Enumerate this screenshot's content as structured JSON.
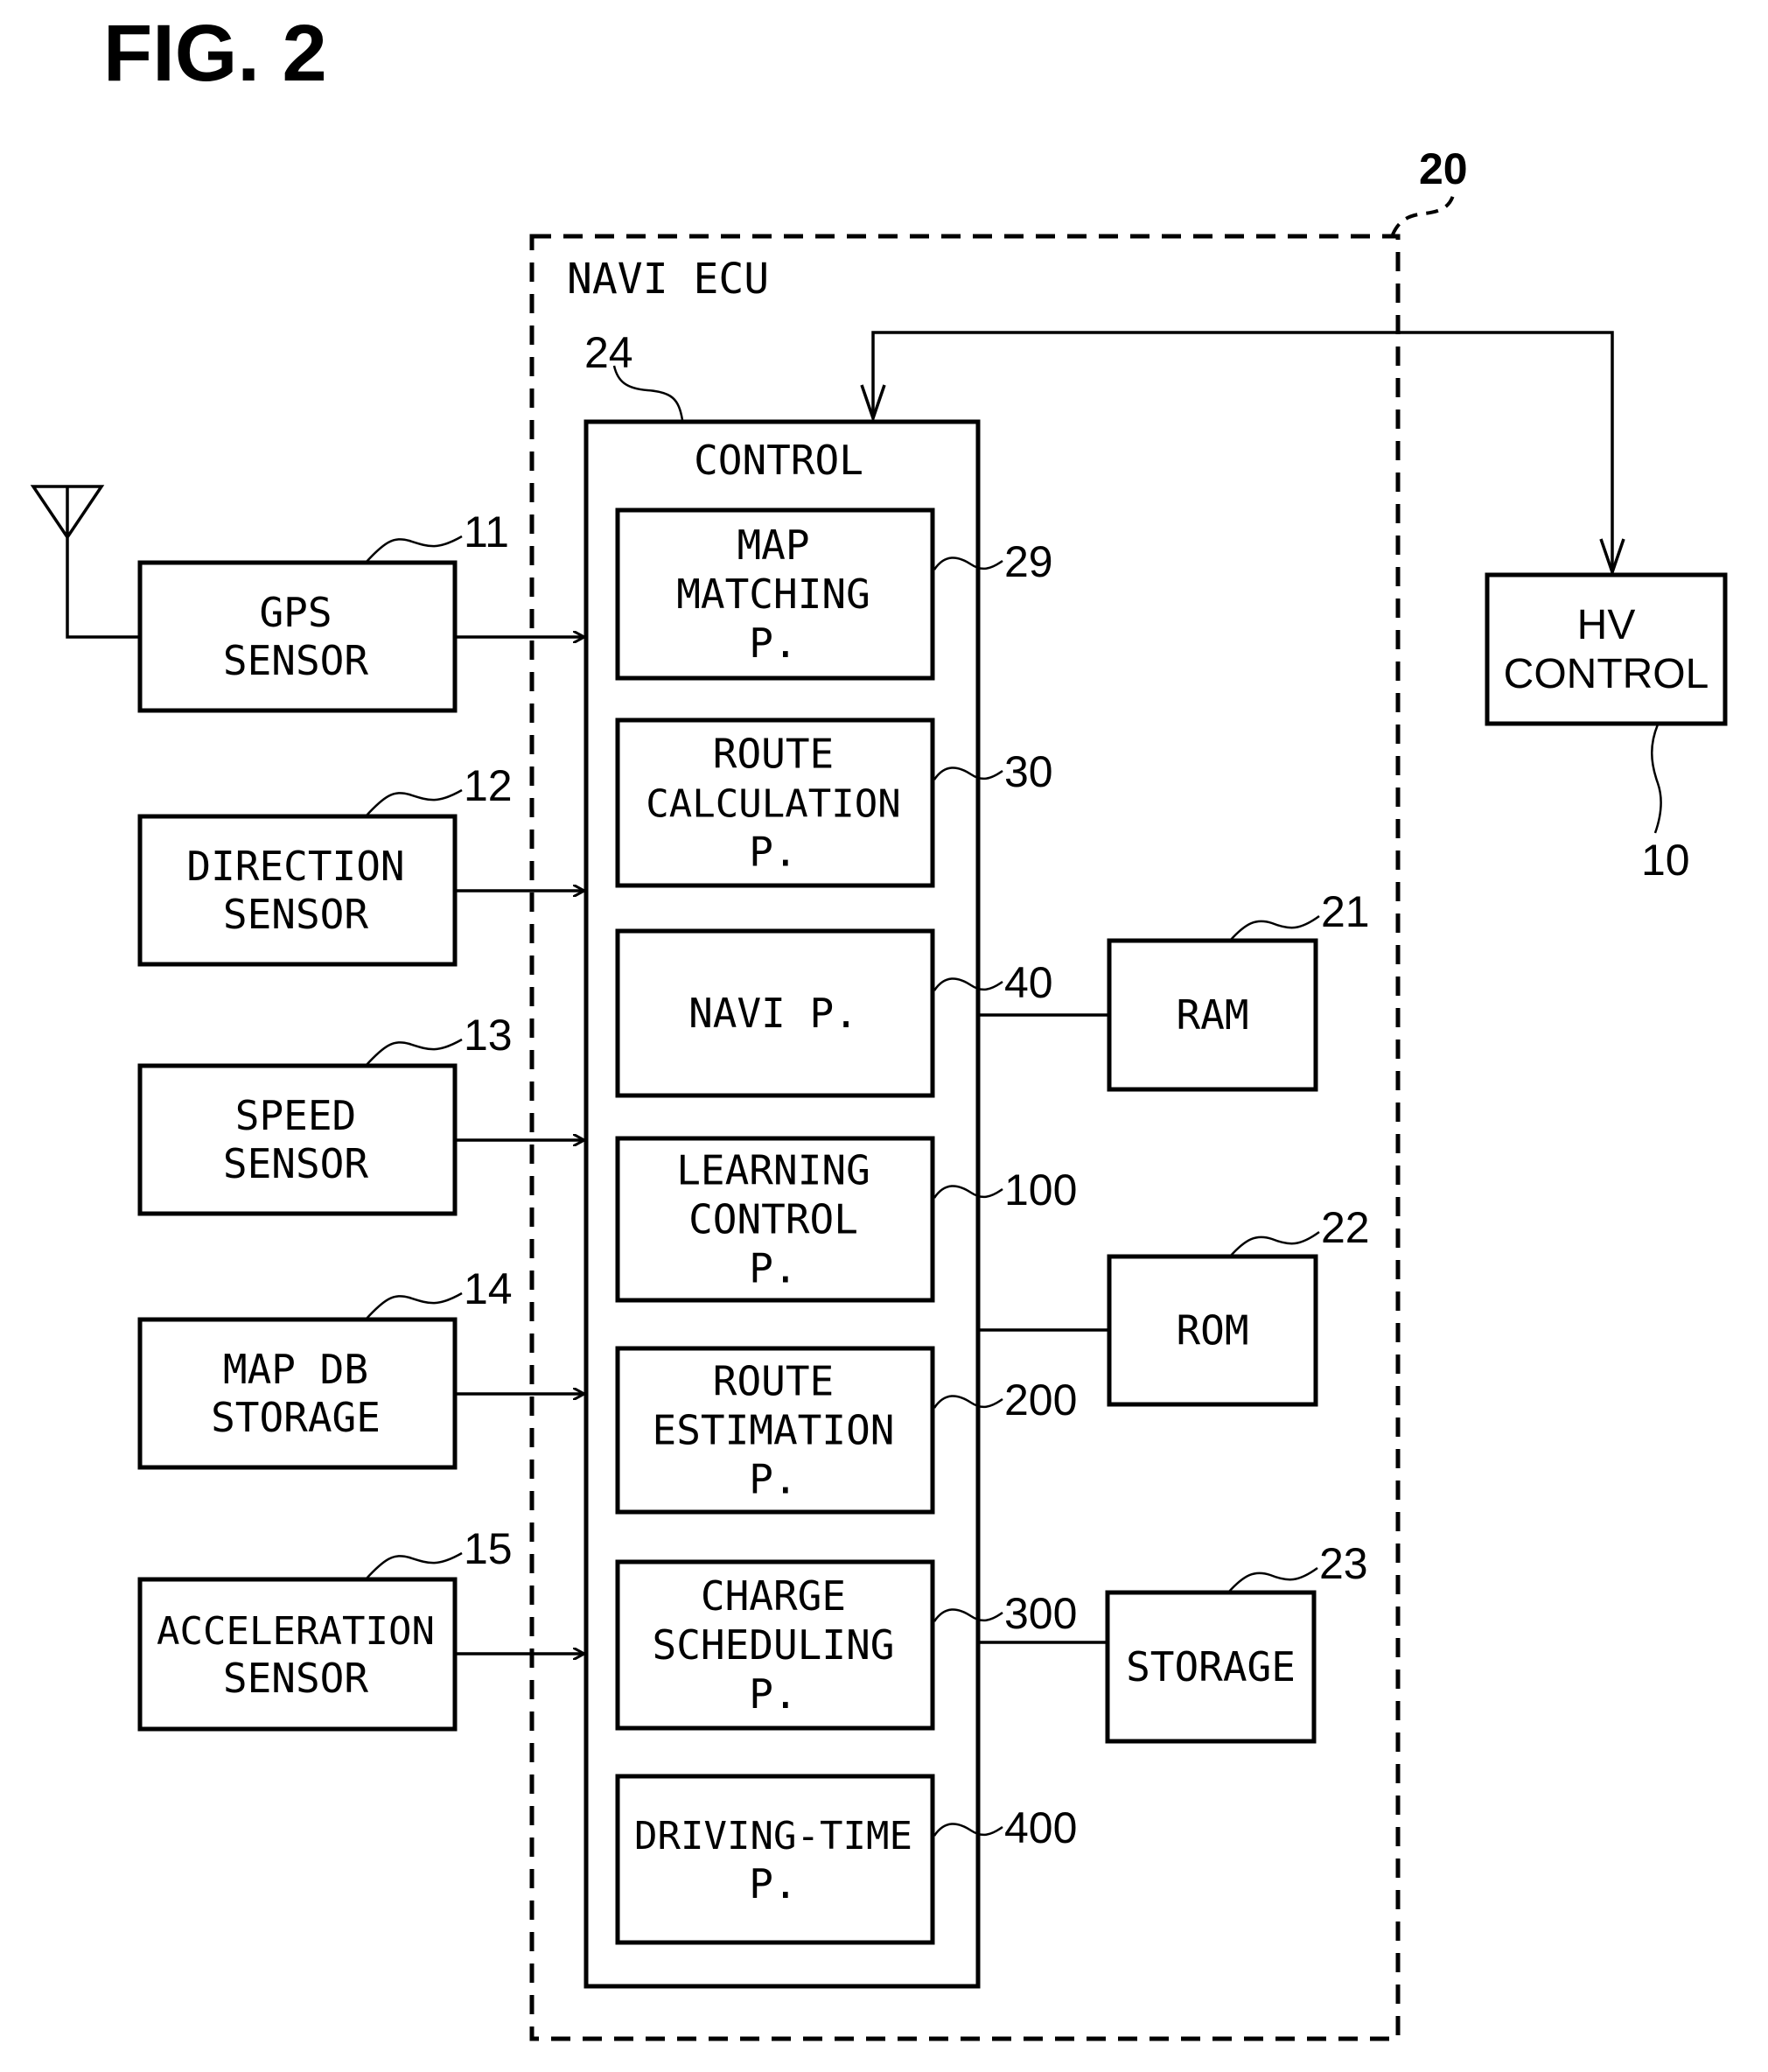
{
  "figure": {
    "title": "FIG. 2"
  },
  "antenna": {
    "icon": "antenna-icon"
  },
  "sensors": [
    {
      "ref": "11",
      "lines": [
        "GPS",
        "SENSOR"
      ]
    },
    {
      "ref": "12",
      "lines": [
        "DIRECTION",
        "SENSOR"
      ]
    },
    {
      "ref": "13",
      "lines": [
        "SPEED",
        "SENSOR"
      ]
    },
    {
      "ref": "14",
      "lines": [
        "MAP DB",
        "STORAGE"
      ]
    },
    {
      "ref": "15",
      "lines": [
        "ACCELERATION",
        "SENSOR"
      ]
    }
  ],
  "ecu": {
    "ref": "20",
    "label": "NAVI ECU",
    "control": {
      "ref": "24",
      "label": "CONTROL",
      "programs": [
        {
          "ref": "29",
          "lines": [
            "MAP",
            "MATCHING",
            "P."
          ]
        },
        {
          "ref": "30",
          "lines": [
            "ROUTE",
            "CALCULATION",
            "P."
          ]
        },
        {
          "ref": "40",
          "lines": [
            "NAVI P."
          ]
        },
        {
          "ref": "100",
          "lines": [
            "LEARNING",
            "CONTROL",
            "P."
          ]
        },
        {
          "ref": "200",
          "lines": [
            "ROUTE",
            "ESTIMATION",
            "P."
          ]
        },
        {
          "ref": "300",
          "lines": [
            "CHARGE",
            "SCHEDULING",
            "P."
          ]
        },
        {
          "ref": "400",
          "lines": [
            "DRIVING-TIME",
            "P."
          ]
        }
      ]
    },
    "memory": [
      {
        "ref": "21",
        "label": "RAM"
      },
      {
        "ref": "22",
        "label": "ROM"
      },
      {
        "ref": "23",
        "label": "STORAGE"
      }
    ]
  },
  "hv_control": {
    "ref": "10",
    "lines": [
      "HV",
      "CONTROL"
    ]
  }
}
